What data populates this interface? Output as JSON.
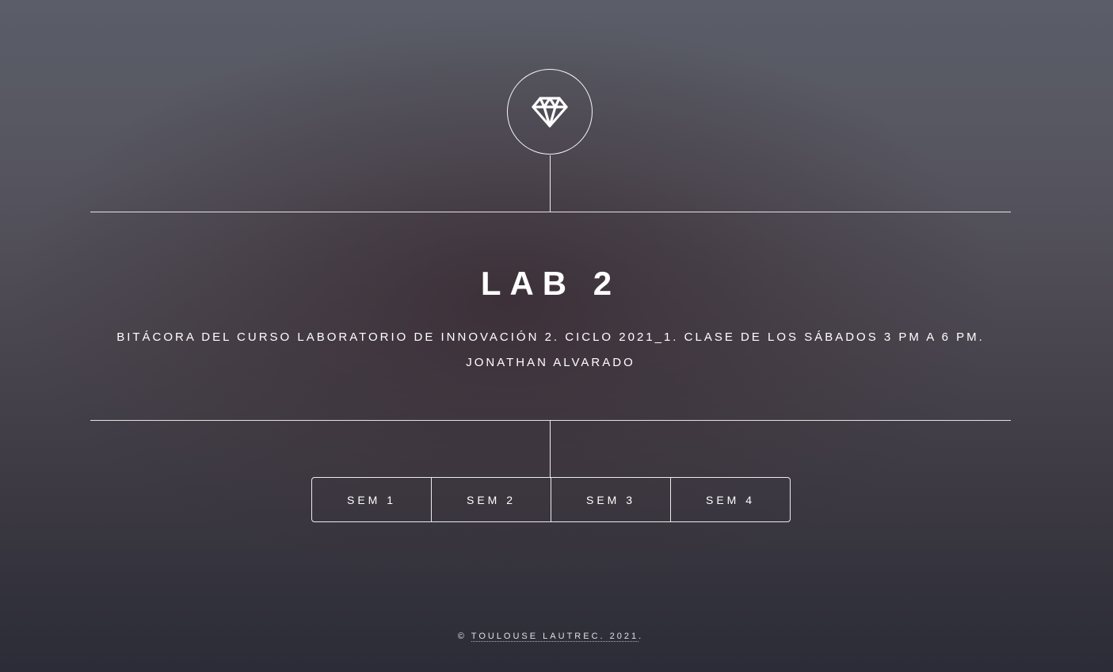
{
  "header": {
    "logo_icon": "diamond-icon"
  },
  "main": {
    "title": "LAB 2",
    "subtitle_line1": "BITÁCORA DEL CURSO LABORATORIO DE INNOVACIÓN 2. CICLO 2021_1. CLASE DE LOS SÁBADOS 3 PM A 6 PM.",
    "subtitle_line2": "JONATHAN ALVARADO"
  },
  "nav": {
    "items": [
      {
        "label": "SEM 1"
      },
      {
        "label": "SEM 2"
      },
      {
        "label": "SEM 3"
      },
      {
        "label": "SEM 4"
      }
    ]
  },
  "footer": {
    "copyright_symbol": "©",
    "link_text": "TOULOUSE LAUTREC. 2021",
    "suffix": "."
  },
  "colors": {
    "text": "#ffffff",
    "background_top": "#5a5e68",
    "background_bottom": "#2b2c37"
  }
}
